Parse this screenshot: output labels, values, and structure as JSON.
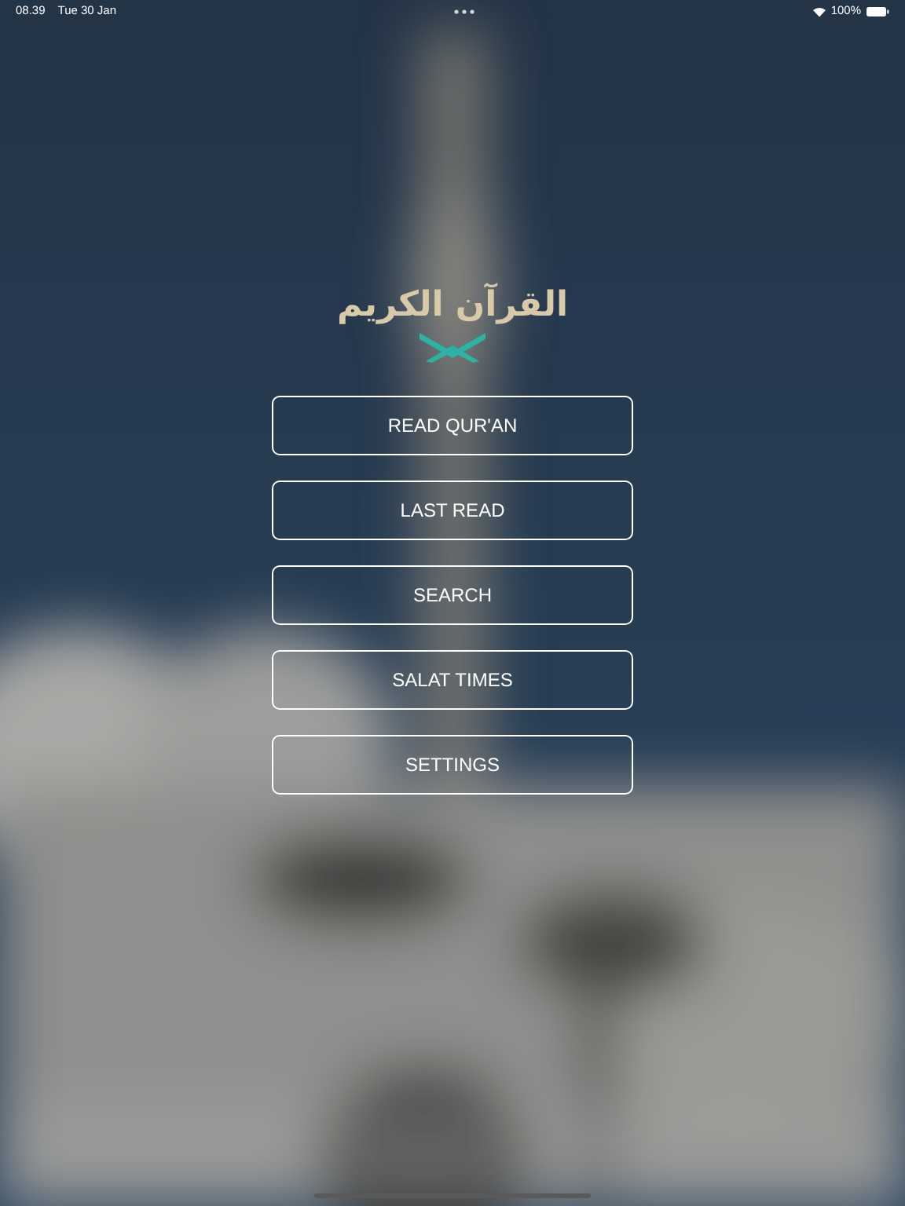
{
  "status_bar": {
    "time": "08.39",
    "date": "Tue 30 Jan",
    "battery": "100%"
  },
  "logo": {
    "title": "القرآن الكريم"
  },
  "menu": [
    {
      "label": "READ QUR'AN"
    },
    {
      "label": "LAST READ"
    },
    {
      "label": "SEARCH"
    },
    {
      "label": "SALAT TIMES"
    },
    {
      "label": "SETTINGS"
    }
  ]
}
